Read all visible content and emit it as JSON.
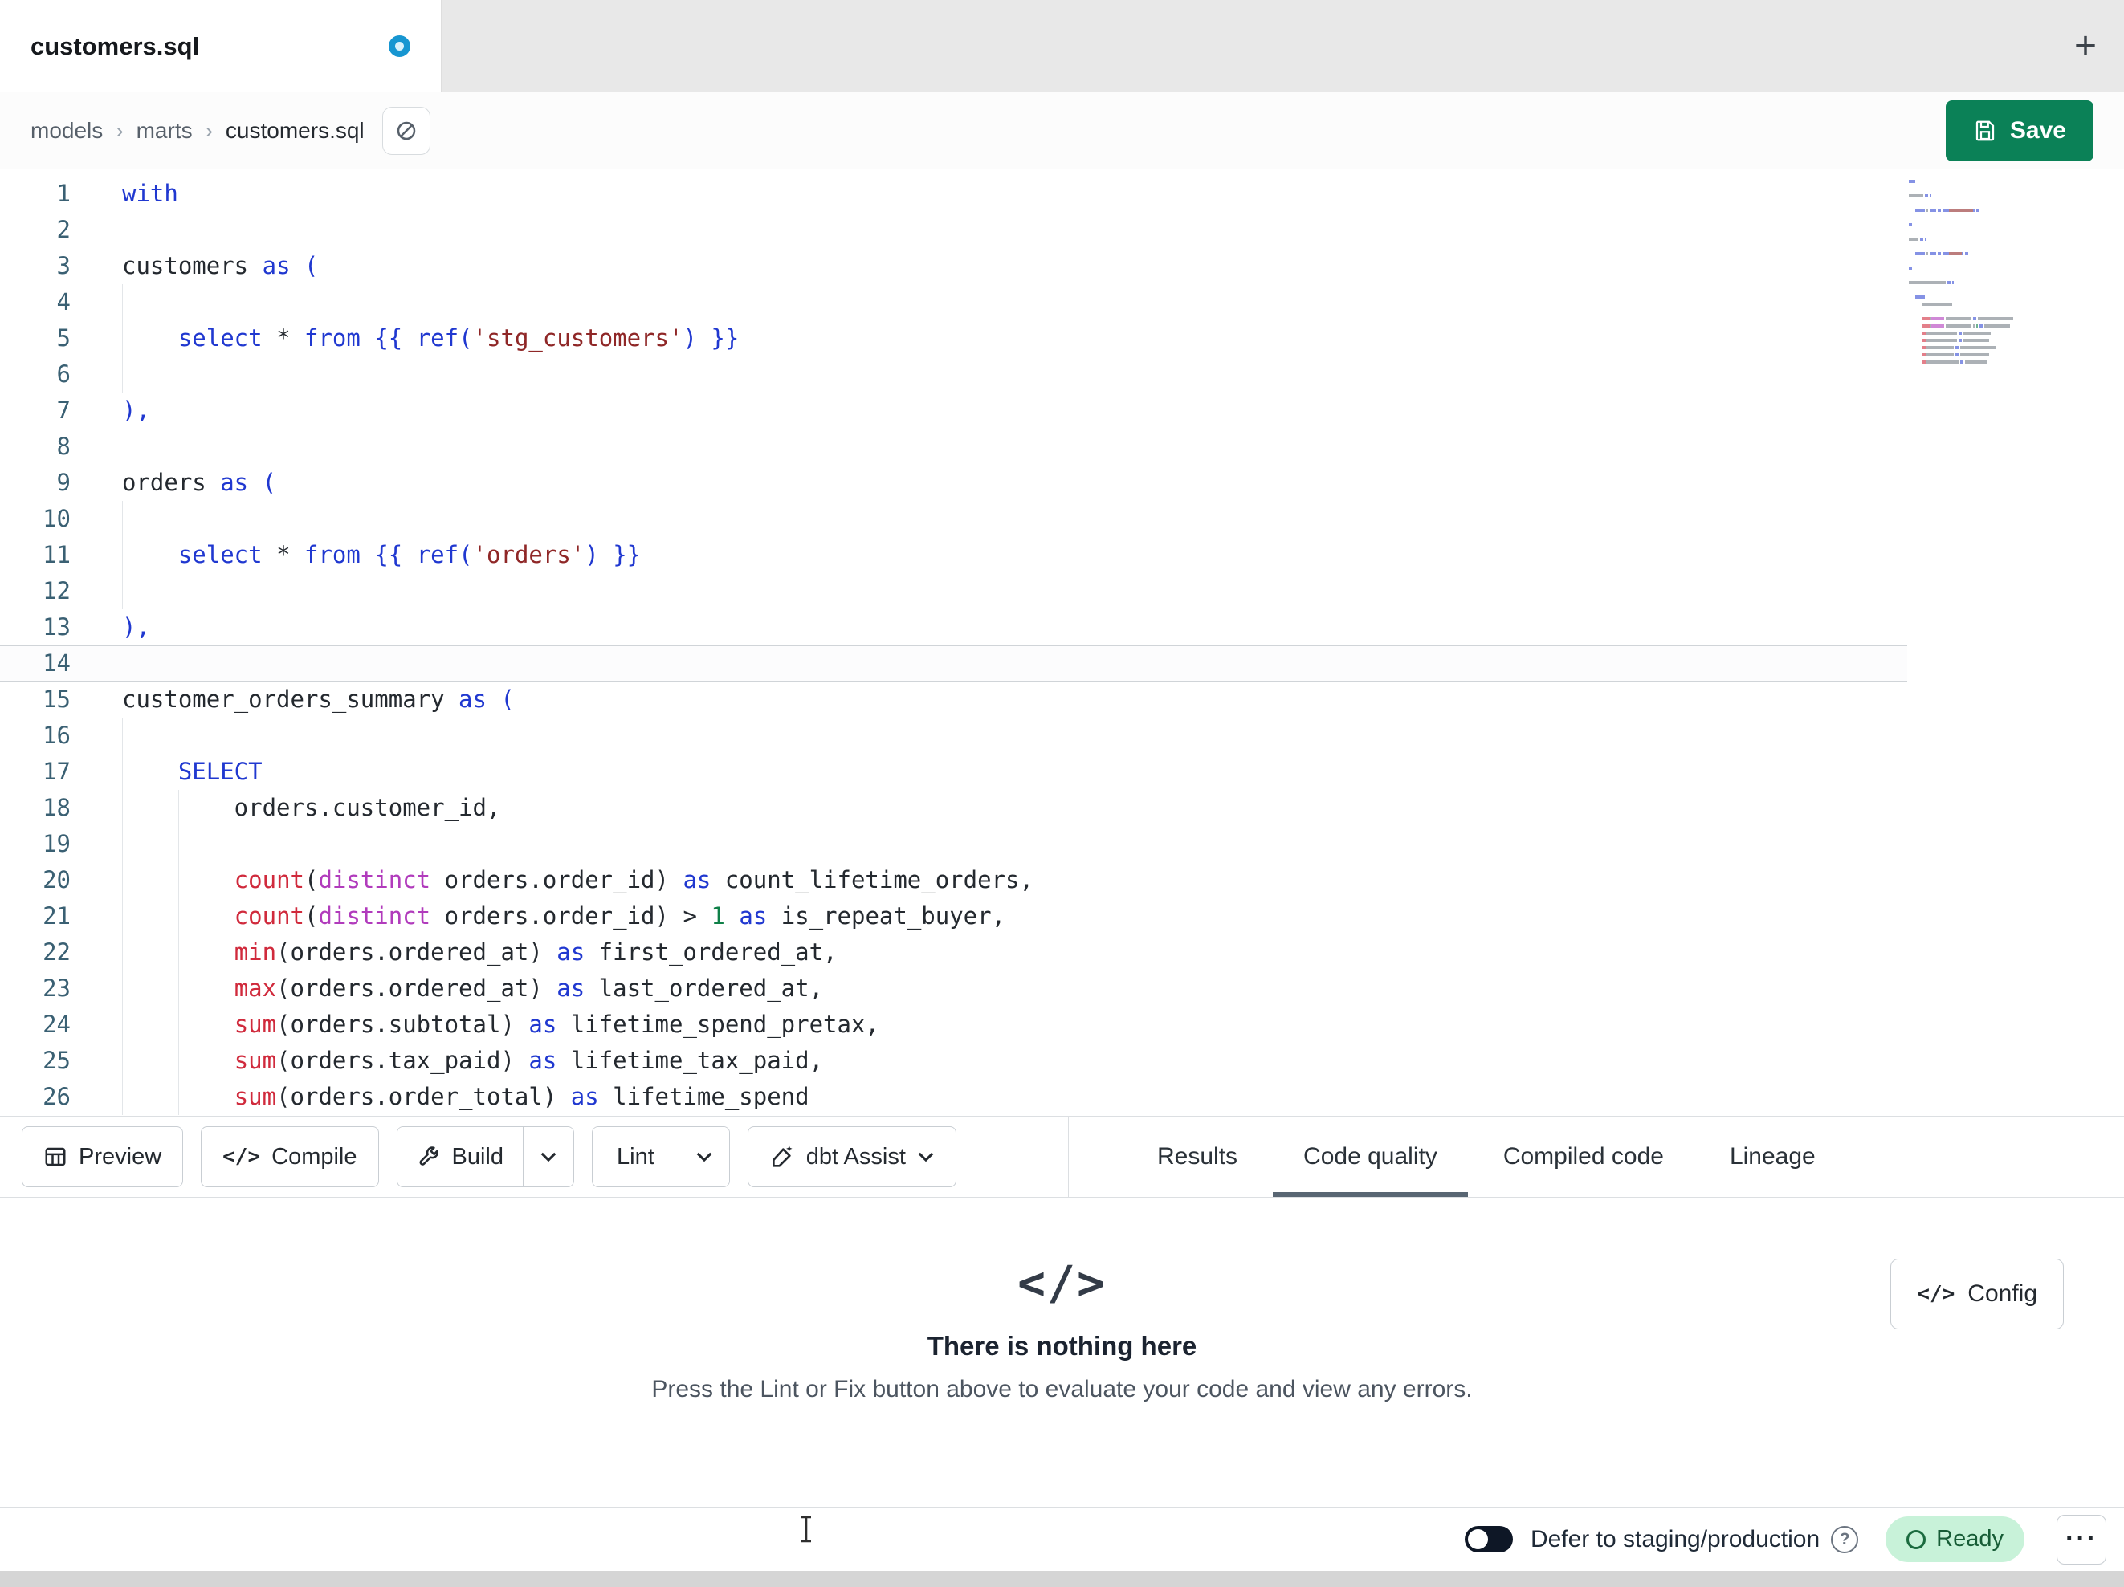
{
  "colors": {
    "save_button_green": "#0B8157",
    "tab_unsaved_dot_blue": "#1796D1",
    "ready_badge_bg": "#C8F2D9",
    "ready_badge_text": "#175C36",
    "keyword_blue": "#2038D0",
    "function_red": "#D02A3C",
    "string_dark_red": "#8F2727",
    "distinct_magenta": "#B13BBC",
    "number_green": "#0F8048"
  },
  "tabbar": {
    "tab_title": "customers.sql",
    "new_tab_icon": "+"
  },
  "filebar": {
    "breadcrumb": {
      "items": [
        "models",
        "marts",
        "customers.sql"
      ],
      "separator": "›"
    },
    "save_label": "Save"
  },
  "editor": {
    "active_line": 14,
    "guides": [
      {
        "from": 4,
        "to": 6,
        "col": 0
      },
      {
        "from": 10,
        "to": 12,
        "col": 0
      },
      {
        "from": 16,
        "to": 26,
        "col": 0
      },
      {
        "from": 18,
        "to": 26,
        "col": 4
      }
    ],
    "lines": [
      {
        "n": 1,
        "t": [
          [
            "with",
            "kw"
          ]
        ]
      },
      {
        "n": 2,
        "t": []
      },
      {
        "n": 3,
        "t": [
          [
            "customers ",
            "id"
          ],
          [
            "as",
            "kw"
          ],
          [
            " ",
            "id"
          ],
          [
            "(",
            "br"
          ]
        ]
      },
      {
        "n": 4,
        "t": []
      },
      {
        "n": 5,
        "t": [
          [
            "    ",
            "id"
          ],
          [
            "select",
            "kw"
          ],
          [
            " ",
            "id"
          ],
          [
            "*",
            "op"
          ],
          [
            " ",
            "id"
          ],
          [
            "from",
            "kw"
          ],
          [
            " ",
            "id"
          ],
          [
            "{{ ",
            "br"
          ],
          [
            "ref",
            "kw"
          ],
          [
            "(",
            "br"
          ],
          [
            "'stg_customers'",
            "str"
          ],
          [
            ")",
            "br"
          ],
          [
            " }}",
            "br"
          ]
        ]
      },
      {
        "n": 6,
        "t": []
      },
      {
        "n": 7,
        "t": [
          [
            "),",
            "br"
          ]
        ]
      },
      {
        "n": 8,
        "t": []
      },
      {
        "n": 9,
        "t": [
          [
            "orders ",
            "id"
          ],
          [
            "as",
            "kw"
          ],
          [
            " ",
            "id"
          ],
          [
            "(",
            "br"
          ]
        ]
      },
      {
        "n": 10,
        "t": []
      },
      {
        "n": 11,
        "t": [
          [
            "    ",
            "id"
          ],
          [
            "select",
            "kw"
          ],
          [
            " ",
            "id"
          ],
          [
            "*",
            "op"
          ],
          [
            " ",
            "id"
          ],
          [
            "from",
            "kw"
          ],
          [
            " ",
            "id"
          ],
          [
            "{{ ",
            "br"
          ],
          [
            "ref",
            "kw"
          ],
          [
            "(",
            "br"
          ],
          [
            "'orders'",
            "str"
          ],
          [
            ")",
            "br"
          ],
          [
            " }}",
            "br"
          ]
        ]
      },
      {
        "n": 12,
        "t": []
      },
      {
        "n": 13,
        "t": [
          [
            "),",
            "br"
          ]
        ]
      },
      {
        "n": 14,
        "t": []
      },
      {
        "n": 15,
        "t": [
          [
            "customer_orders_summary ",
            "id"
          ],
          [
            "as",
            "kw"
          ],
          [
            " ",
            "id"
          ],
          [
            "(",
            "br"
          ]
        ]
      },
      {
        "n": 16,
        "t": []
      },
      {
        "n": 17,
        "t": [
          [
            "    ",
            "id"
          ],
          [
            "SELECT",
            "kw"
          ]
        ]
      },
      {
        "n": 18,
        "t": [
          [
            "        orders.customer_id,",
            "id"
          ]
        ]
      },
      {
        "n": 19,
        "t": []
      },
      {
        "n": 20,
        "t": [
          [
            "        ",
            "id"
          ],
          [
            "count",
            "fn"
          ],
          [
            "(",
            "pn"
          ],
          [
            "distinct",
            "mg"
          ],
          [
            " orders.order_id",
            "id"
          ],
          [
            ")",
            "pn"
          ],
          [
            " ",
            "id"
          ],
          [
            "as",
            "kw"
          ],
          [
            " count_lifetime_orders,",
            "id"
          ]
        ]
      },
      {
        "n": 21,
        "t": [
          [
            "        ",
            "id"
          ],
          [
            "count",
            "fn"
          ],
          [
            "(",
            "pn"
          ],
          [
            "distinct",
            "mg"
          ],
          [
            " orders.order_id",
            "id"
          ],
          [
            ")",
            "pn"
          ],
          [
            " > ",
            "op"
          ],
          [
            "1",
            "num"
          ],
          [
            " ",
            "id"
          ],
          [
            "as",
            "kw"
          ],
          [
            " is_repeat_buyer,",
            "id"
          ]
        ]
      },
      {
        "n": 22,
        "t": [
          [
            "        ",
            "id"
          ],
          [
            "min",
            "fn"
          ],
          [
            "(",
            "pn"
          ],
          [
            "orders.ordered_at",
            "id"
          ],
          [
            ")",
            "pn"
          ],
          [
            " ",
            "id"
          ],
          [
            "as",
            "kw"
          ],
          [
            " first_ordered_at,",
            "id"
          ]
        ]
      },
      {
        "n": 23,
        "t": [
          [
            "        ",
            "id"
          ],
          [
            "max",
            "fn"
          ],
          [
            "(",
            "pn"
          ],
          [
            "orders.ordered_at",
            "id"
          ],
          [
            ")",
            "pn"
          ],
          [
            " ",
            "id"
          ],
          [
            "as",
            "kw"
          ],
          [
            " last_ordered_at,",
            "id"
          ]
        ]
      },
      {
        "n": 24,
        "t": [
          [
            "        ",
            "id"
          ],
          [
            "sum",
            "fn"
          ],
          [
            "(",
            "pn"
          ],
          [
            "orders.subtotal",
            "id"
          ],
          [
            ")",
            "pn"
          ],
          [
            " ",
            "id"
          ],
          [
            "as",
            "kw"
          ],
          [
            " lifetime_spend_pretax,",
            "id"
          ]
        ]
      },
      {
        "n": 25,
        "t": [
          [
            "        ",
            "id"
          ],
          [
            "sum",
            "fn"
          ],
          [
            "(",
            "pn"
          ],
          [
            "orders.tax_paid",
            "id"
          ],
          [
            ")",
            "pn"
          ],
          [
            " ",
            "id"
          ],
          [
            "as",
            "kw"
          ],
          [
            " lifetime_tax_paid,",
            "id"
          ]
        ]
      },
      {
        "n": 26,
        "t": [
          [
            "        ",
            "id"
          ],
          [
            "sum",
            "fn"
          ],
          [
            "(",
            "pn"
          ],
          [
            "orders.order_total",
            "id"
          ],
          [
            ")",
            "pn"
          ],
          [
            " ",
            "id"
          ],
          [
            "as",
            "kw"
          ],
          [
            " lifetime_spend",
            "id"
          ]
        ]
      }
    ]
  },
  "toolbar": {
    "preview": {
      "label": "Preview",
      "icon": "table-icon"
    },
    "compile": {
      "label": "Compile",
      "icon": "code-icon",
      "icon_glyph": "</>"
    },
    "build": {
      "label": "Build",
      "icon": "wrench-icon",
      "has_dropdown": true
    },
    "lint": {
      "label": "Lint",
      "has_dropdown": true
    },
    "assist": {
      "label": "dbt Assist",
      "icon": "sparkle-pencil-icon",
      "has_dropdown": true
    }
  },
  "result_tabs": [
    {
      "label": "Results",
      "active": false
    },
    {
      "label": "Code quality",
      "active": true
    },
    {
      "label": "Compiled code",
      "active": false
    },
    {
      "label": "Lineage",
      "active": false
    }
  ],
  "empty_state": {
    "icon": "code-icon",
    "icon_glyph": "</>",
    "title": "There is nothing here",
    "subtitle": "Press the Lint or Fix button above to evaluate your code and view any errors.",
    "config_label": "Config",
    "config_icon_glyph": "</>"
  },
  "status_bar": {
    "defer_toggle_on": false,
    "defer_label": "Defer to staging/production",
    "help_glyph": "?",
    "ready_label": "Ready",
    "overflow_glyph": "···"
  }
}
